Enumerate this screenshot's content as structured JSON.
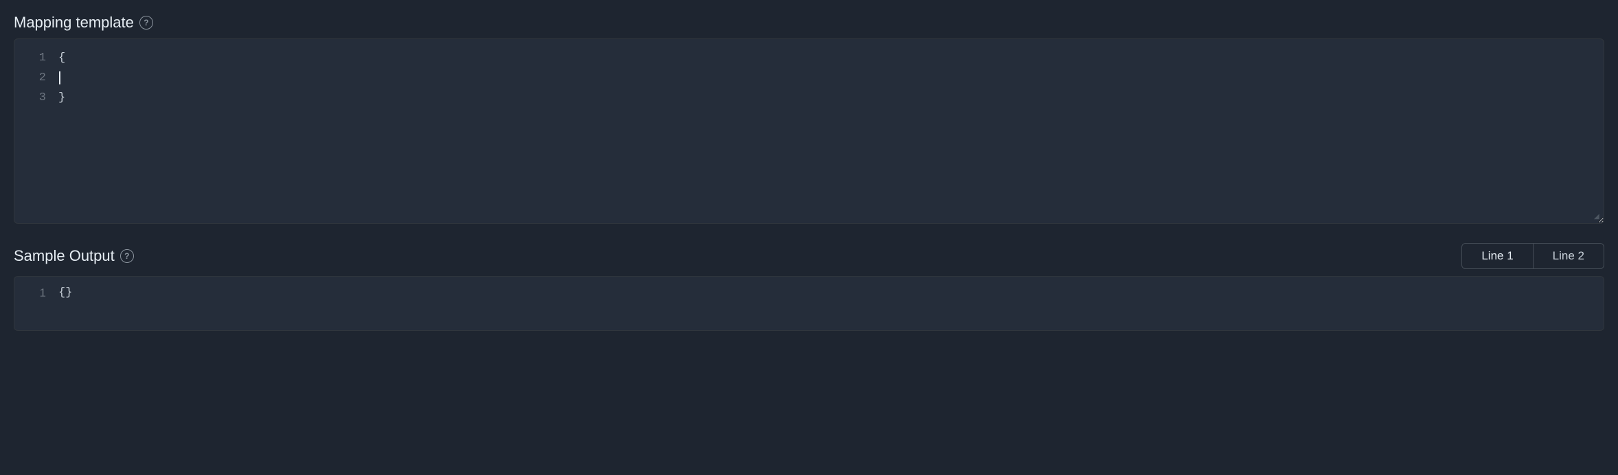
{
  "mapping_template": {
    "title": "Mapping template",
    "help_icon_label": "?",
    "editor": {
      "lines": [
        {
          "number": "1",
          "content": "{"
        },
        {
          "number": "2",
          "content": "  ",
          "has_cursor": true
        },
        {
          "number": "3",
          "content": "}"
        }
      ]
    }
  },
  "sample_output": {
    "title": "Sample Output",
    "help_icon_label": "?",
    "tabs": [
      {
        "label": "Line 1",
        "active": true
      },
      {
        "label": "Line 2",
        "active": false
      }
    ],
    "output_lines": [
      {
        "number": "1",
        "content": "{}"
      }
    ]
  }
}
